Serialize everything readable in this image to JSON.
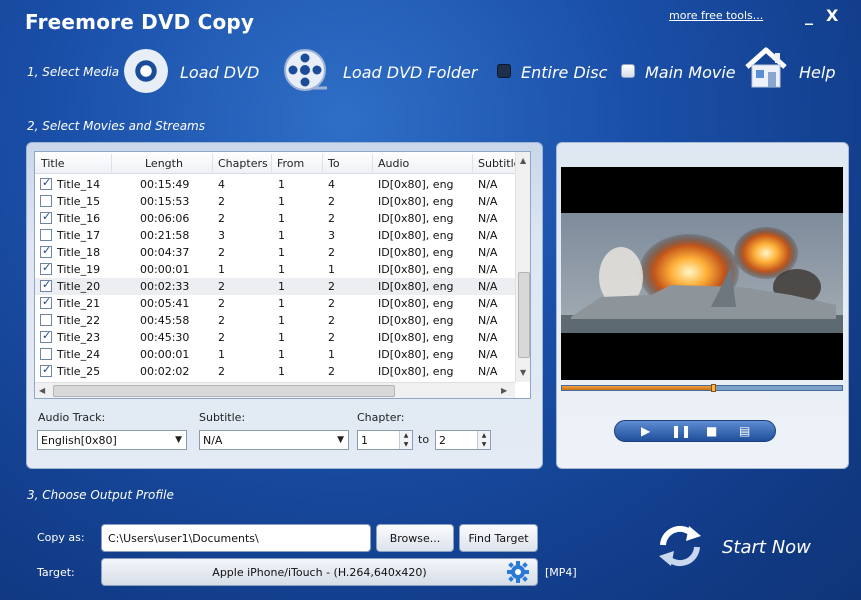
{
  "app": {
    "title": "Freemore DVD Copy",
    "more_link": "more free tools...",
    "minimize": "_",
    "close": "X"
  },
  "toolbar": {
    "step1": "1, Select Media",
    "load_dvd": "Load DVD",
    "load_folder": "Load DVD Folder",
    "entire_disc": "Entire Disc",
    "main_movie": "Main Movie",
    "help": "Help"
  },
  "step2": "2, Select Movies and Streams",
  "table": {
    "columns": [
      "Title",
      "Length",
      "Chapters",
      "From",
      "To",
      "Audio",
      "Subtitle"
    ],
    "rows": [
      {
        "checked": true,
        "title": "Title_14",
        "length": "00:15:49",
        "chapters": "4",
        "from": "1",
        "to": "4",
        "audio": "ID[0x80], eng",
        "subtitle": "N/A"
      },
      {
        "checked": false,
        "title": "Title_15",
        "length": "00:15:53",
        "chapters": "2",
        "from": "1",
        "to": "2",
        "audio": "ID[0x80], eng",
        "subtitle": "N/A"
      },
      {
        "checked": true,
        "title": "Title_16",
        "length": "00:06:06",
        "chapters": "2",
        "from": "1",
        "to": "2",
        "audio": "ID[0x80], eng",
        "subtitle": "N/A"
      },
      {
        "checked": false,
        "title": "Title_17",
        "length": "00:21:58",
        "chapters": "3",
        "from": "1",
        "to": "3",
        "audio": "ID[0x80], eng",
        "subtitle": "N/A"
      },
      {
        "checked": true,
        "title": "Title_18",
        "length": "00:04:37",
        "chapters": "2",
        "from": "1",
        "to": "2",
        "audio": "ID[0x80], eng",
        "subtitle": "N/A"
      },
      {
        "checked": true,
        "title": "Title_19",
        "length": "00:00:01",
        "chapters": "1",
        "from": "1",
        "to": "1",
        "audio": "ID[0x80], eng",
        "subtitle": "N/A"
      },
      {
        "checked": true,
        "title": "Title_20",
        "length": "00:02:33",
        "chapters": "2",
        "from": "1",
        "to": "2",
        "audio": "ID[0x80], eng",
        "subtitle": "N/A"
      },
      {
        "checked": true,
        "title": "Title_21",
        "length": "00:05:41",
        "chapters": "2",
        "from": "1",
        "to": "2",
        "audio": "ID[0x80], eng",
        "subtitle": "N/A"
      },
      {
        "checked": false,
        "title": "Title_22",
        "length": "00:45:58",
        "chapters": "2",
        "from": "1",
        "to": "2",
        "audio": "ID[0x80], eng",
        "subtitle": "N/A"
      },
      {
        "checked": true,
        "title": "Title_23",
        "length": "00:45:30",
        "chapters": "2",
        "from": "1",
        "to": "2",
        "audio": "ID[0x80], eng",
        "subtitle": "N/A"
      },
      {
        "checked": false,
        "title": "Title_24",
        "length": "00:00:01",
        "chapters": "1",
        "from": "1",
        "to": "1",
        "audio": "ID[0x80], eng",
        "subtitle": "N/A"
      },
      {
        "checked": true,
        "title": "Title_25",
        "length": "00:02:02",
        "chapters": "2",
        "from": "1",
        "to": "2",
        "audio": "ID[0x80], eng",
        "subtitle": "N/A"
      }
    ],
    "selected_row": 6
  },
  "streams": {
    "audio_label": "Audio Track:",
    "audio_value": "English[0x80]",
    "subtitle_label": "Subtitle:",
    "subtitle_value": "N/A",
    "chapter_label": "Chapter:",
    "chapter_from": "1",
    "chapter_to_label": "to",
    "chapter_to": "2"
  },
  "player": {
    "progress": 0.54
  },
  "step3": "3, Choose Output Profile",
  "output": {
    "copy_as_label": "Copy as:",
    "path": "C:\\Users\\user1\\Documents\\",
    "browse": "Browse...",
    "find_target": "Find Target",
    "target_label": "Target:",
    "target_value": "Apple iPhone/iTouch - (H.264,640x420)",
    "format": "[MP4]",
    "start": "Start Now"
  },
  "colors": {
    "background": "#1a4fa8",
    "progress": "#f2a13c",
    "accent": "#2a7ad8"
  }
}
